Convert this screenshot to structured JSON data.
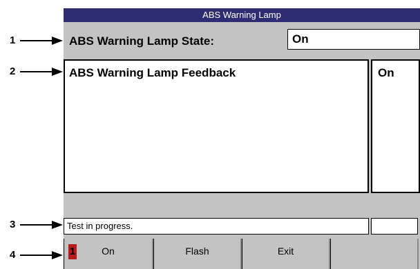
{
  "window": {
    "title": "ABS Warning Lamp"
  },
  "callouts": [
    "1",
    "2",
    "3",
    "4"
  ],
  "state": {
    "label": "ABS Warning Lamp State:",
    "value": "On"
  },
  "feedback": {
    "label": "ABS Warning Lamp Feedback",
    "value": "On"
  },
  "status": {
    "text": "Test in progress."
  },
  "softkeys": [
    {
      "number": "1",
      "label": "On"
    },
    {
      "label": "Flash"
    },
    {
      "label": "Exit"
    },
    {
      "label": ""
    }
  ],
  "colors": {
    "titlebar": "#2e2d74",
    "panel": "#c3c3c3",
    "key_number": "#b81c1c"
  }
}
